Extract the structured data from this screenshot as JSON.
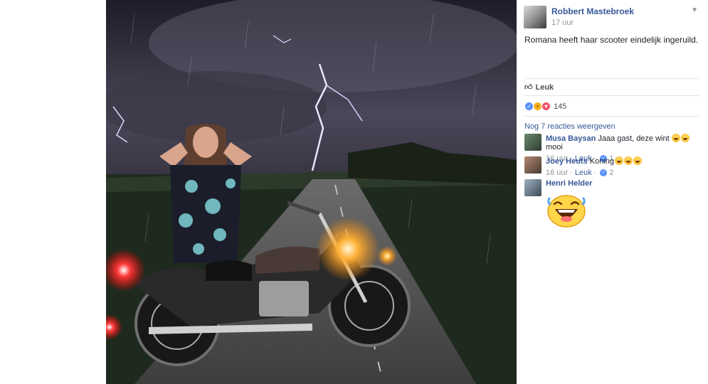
{
  "post": {
    "author": "Robbert Mastebroek",
    "time": "17 uur",
    "text": "Romana heeft haar scooter eindelijk ingeruild.",
    "menu_icon": "chevron-down-icon"
  },
  "actions": {
    "like_label": "Leuk"
  },
  "reactions": {
    "count": "145",
    "icons": [
      "like-reaction-icon",
      "haha-reaction-icon",
      "love-reaction-icon"
    ]
  },
  "comments_section": {
    "more_label": "Nog 7 reacties weergeven",
    "comments": [
      {
        "author": "Musa Baysan",
        "text": "Jaaa gast, deze wint",
        "text_after": "mooi",
        "time": "16 uur",
        "like_label": "Leuk",
        "likes": "1"
      },
      {
        "author": "Joey Heuts",
        "text": "Koning",
        "time": "16 uur",
        "like_label": "Leuk",
        "likes": "2"
      },
      {
        "author": "Henri Helder",
        "sticker": "laughing-face-sticker"
      }
    ]
  },
  "colors": {
    "link": "#365899",
    "meta": "#90949c",
    "like_blue": "#5890ff"
  }
}
